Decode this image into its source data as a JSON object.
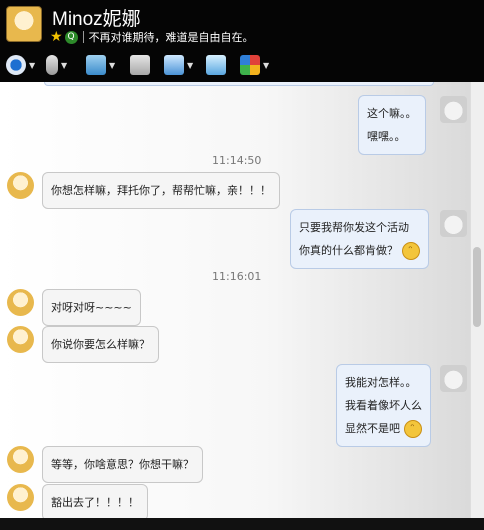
{
  "header": {
    "name": "Minoz妮娜",
    "signature": "不再对谁期待，难道是自由自在。",
    "status_badge": "Q"
  },
  "toolbar": {
    "icons": [
      "video-call-icon",
      "voice-call-icon",
      "send-file-icon",
      "add-contact-icon",
      "remote-assist-icon",
      "share-screen-icon",
      "apps-icon"
    ]
  },
  "colors": {
    "header_bg": "#050505",
    "bubble_me": "#eaf1fb",
    "bubble_other": "#f5f5f5"
  },
  "messages": [
    {
      "side": "right",
      "lines": [
        "这个嘛。。",
        "嘿嘿。。"
      ]
    },
    {
      "time": "11:14:50"
    },
    {
      "side": "left",
      "lines": [
        "你想怎样嘛，拜托你了，帮帮忙嘛，亲！！！"
      ]
    },
    {
      "side": "right",
      "lines": [
        "只要我帮你发这个活动",
        "你真的什么都肯做？"
      ],
      "emoji": "grin"
    },
    {
      "time": "11:16:01"
    },
    {
      "side": "left",
      "lines": [
        "对呀对呀~~~~"
      ]
    },
    {
      "side": "left",
      "lines": [
        "你说你要怎么样嘛？"
      ]
    },
    {
      "side": "right",
      "lines": [
        "我能对怎样。。",
        "我看着像坏人么",
        "显然不是吧"
      ],
      "emoji": "grin"
    },
    {
      "side": "left",
      "lines": [
        "等等，你啥意思？你想干嘛？"
      ]
    },
    {
      "side": "left",
      "lines": [
        "豁出去了！！！！"
      ]
    }
  ]
}
